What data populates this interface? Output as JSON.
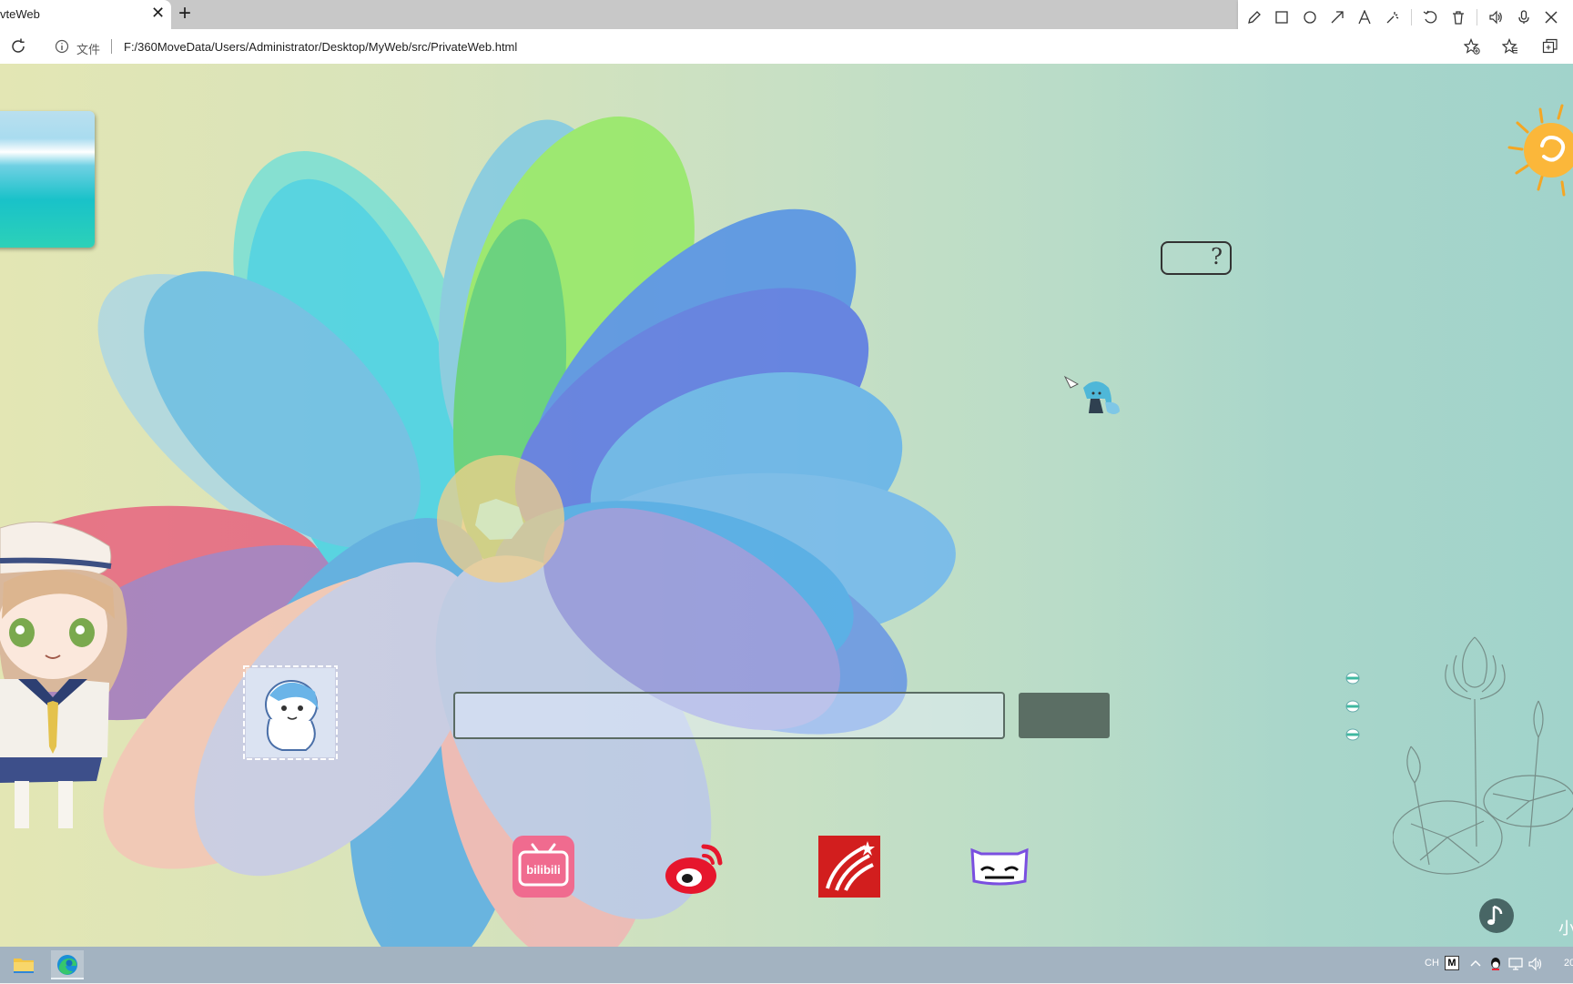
{
  "browser": {
    "tab_title": "vteWeb",
    "tab_close_glyph": "✕",
    "new_tab_glyph": "+",
    "file_label": "文件",
    "url": "F:/360MoveData/Users/Administrator/Desktop/MyWeb/src/PrivateWeb.html"
  },
  "annotation_toolbar": {
    "tools": [
      "pen-icon",
      "rectangle-icon",
      "circle-icon",
      "arrow-icon",
      "text-icon",
      "highlighter-icon",
      "undo-icon",
      "trash-icon",
      "speaker-icon",
      "microphone-icon",
      "close-icon"
    ]
  },
  "page": {
    "help_glyph": "?",
    "search": {
      "value": "",
      "placeholder": "",
      "button_label": ""
    },
    "app_links": [
      {
        "name": "bilibili",
        "label": "bilibili",
        "color": "#f06b8f"
      },
      {
        "name": "weibo",
        "color": "#e6162d"
      },
      {
        "name": "xuexitong",
        "color": "#d21e1e"
      },
      {
        "name": "tmall",
        "color": "#7a4fe0"
      }
    ],
    "nav_dots": 3,
    "corner_text": "小"
  },
  "taskbar": {
    "tray_lang": "CH",
    "tray_ime": "M",
    "clock": "20"
  },
  "colors": {
    "search_button": "#5b6e64",
    "taskbar": "#a3b3c1"
  }
}
